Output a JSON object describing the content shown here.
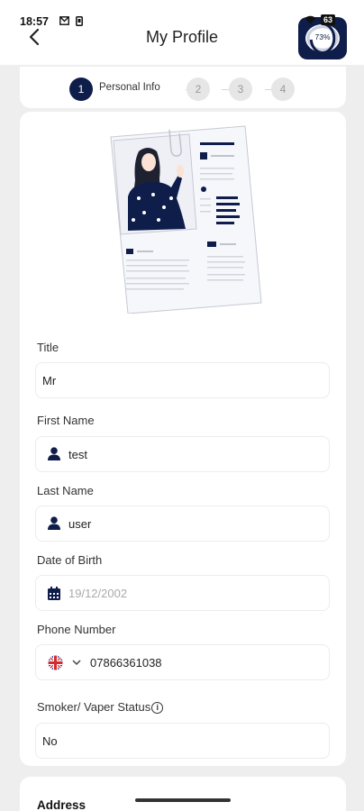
{
  "status_bar": {
    "time": "18:57",
    "battery": "63"
  },
  "header": {
    "title": "My Profile",
    "progress_percent": 73,
    "progress_label": "73%"
  },
  "stepper": {
    "steps": [
      {
        "number": "1",
        "label": "Personal Info",
        "active": true
      },
      {
        "number": "2",
        "active": false
      },
      {
        "number": "3",
        "active": false
      },
      {
        "number": "4",
        "active": false
      }
    ]
  },
  "form": {
    "title": {
      "label": "Title",
      "value": "Mr"
    },
    "first_name": {
      "label": "First Name",
      "value": "test",
      "icon": "person-icon"
    },
    "last_name": {
      "label": "Last Name",
      "value": "user",
      "icon": "person-icon"
    },
    "dob": {
      "label": "Date of Birth",
      "value": "19/12/2002",
      "icon": "calendar-icon"
    },
    "phone": {
      "label": "Phone Number",
      "value": "07866361038",
      "flag": "uk-flag-icon"
    },
    "smoker": {
      "label": "Smoker/ Vaper Status",
      "value": "No"
    }
  },
  "address": {
    "title": "Address"
  },
  "colors": {
    "primary": "#0f1d4a",
    "background": "#eeeeee",
    "card": "#ffffff"
  }
}
